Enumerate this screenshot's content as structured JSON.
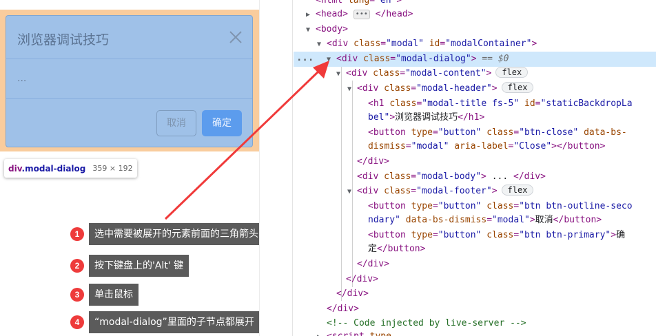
{
  "preview": {
    "modal_title": "浏览器调试技巧",
    "modal_body": "...",
    "cancel_label": "取消",
    "confirm_label": "确定",
    "tooltip_tag": "div",
    "tooltip_class": ".modal-dialog",
    "tooltip_size": "359 × 192"
  },
  "steps": [
    {
      "num": "1",
      "label": "选中需要被展开的元素前面的三角箭头"
    },
    {
      "num": "2",
      "label": "按下键盘上的'Alt' 键"
    },
    {
      "num": "3",
      "label": "单击鼠标"
    },
    {
      "num": "4",
      "label": "“modal-dialog”里面的子节点都展开"
    }
  ],
  "devtools": {
    "ellipsis": "...",
    "flex_badge": "flex",
    "selected_suffix": " == $0",
    "comment": "<!-- Code injected by live-server -->"
  },
  "colors": {
    "arrow": "#f03a3a",
    "selection": "#cfe8fc",
    "margin_overlay": "#f9cc9d",
    "content_overlay": "#9fc1e8",
    "step_badge": "#ee3b3b",
    "step_label_bg": "#5b5b5b"
  },
  "icons": {
    "close": "close-icon",
    "expand": "triangle-down-icon",
    "collapsed": "triangle-right-icon"
  }
}
